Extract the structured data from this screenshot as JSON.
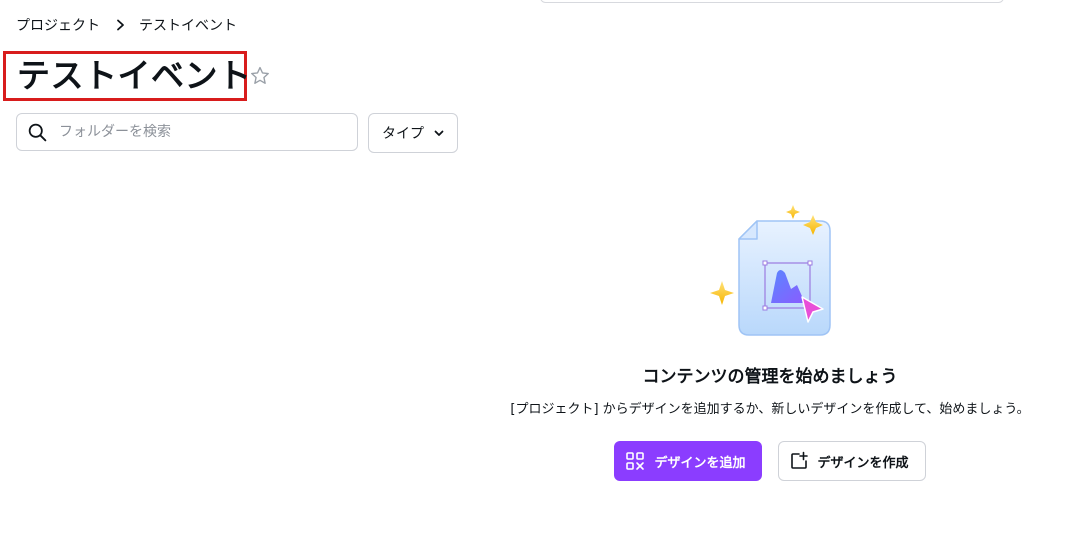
{
  "breadcrumb": {
    "items": [
      "プロジェクト",
      "テストイベント"
    ]
  },
  "page": {
    "title": "テストイベント"
  },
  "search": {
    "placeholder": "フォルダーを検索",
    "value": ""
  },
  "filters": {
    "type_label": "タイプ"
  },
  "empty_state": {
    "title": "コンテンツの管理を始めましょう",
    "description": "[プロジェクト] からデザインを追加するか、新しいデザインを作成して、始めましょう。",
    "add_button_label": "デザインを追加",
    "create_button_label": "デザインを作成"
  },
  "colors": {
    "accent": "#8b3dff",
    "highlight_border": "#d81c1c"
  },
  "icons": {
    "breadcrumb_separator": "chevron-right-icon",
    "favorite": "star-outline-icon",
    "search": "search-icon",
    "filter_dropdown": "chevron-down-icon",
    "add_design": "add-design-grid-icon",
    "create_design": "new-design-icon"
  }
}
